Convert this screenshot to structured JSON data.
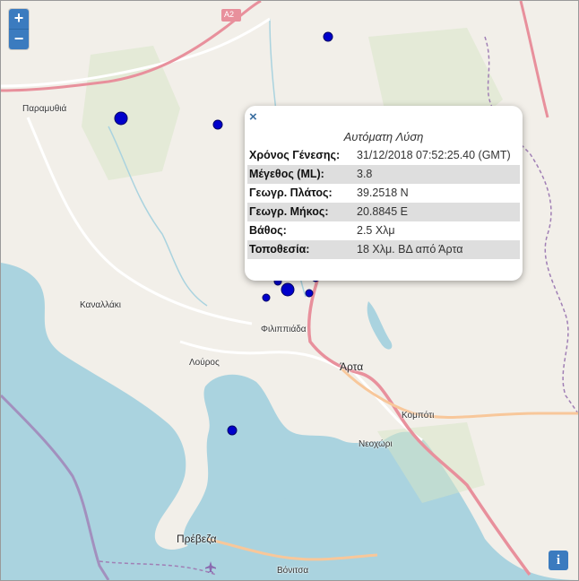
{
  "map": {
    "places": [
      {
        "name": "Παραμυθιά"
      },
      {
        "name": "Καναλλάκι"
      },
      {
        "name": "Φιλιππιάδα"
      },
      {
        "name": "Λούρος"
      },
      {
        "name": "Άρτα"
      },
      {
        "name": "Κομπότι"
      },
      {
        "name": "Νεοχώρι"
      },
      {
        "name": "Πρέβεζα"
      },
      {
        "name": "Βόνιτσα"
      }
    ],
    "road_shield": "A2",
    "colors": {
      "land": "#f2efe9",
      "sea": "#aad3df",
      "marker": "#0000cc",
      "road": "#e8909c",
      "boundary": "#a07fb5"
    }
  },
  "controls": {
    "zoom_in": "+",
    "zoom_out": "−",
    "info": "i",
    "close": "×"
  },
  "popup": {
    "title": "Αυτόματη Λύση",
    "rows": [
      {
        "label": "Χρόνος Γένεσης:",
        "value": "31/12/2018 07:52:25.40 (GMT)"
      },
      {
        "label": "Μέγεθος (ML):",
        "value": "3.8"
      },
      {
        "label": "Γεωγρ. Πλάτος:",
        "value": "39.2518 N"
      },
      {
        "label": "Γεωγρ. Μήκος:",
        "value": "20.8845 E"
      },
      {
        "label": "Βάθος:",
        "value": "2.5 Χλμ"
      },
      {
        "label": "Τοποθεσία:",
        "value": "18 Χλμ. ΒΔ από Άρτα"
      }
    ]
  }
}
